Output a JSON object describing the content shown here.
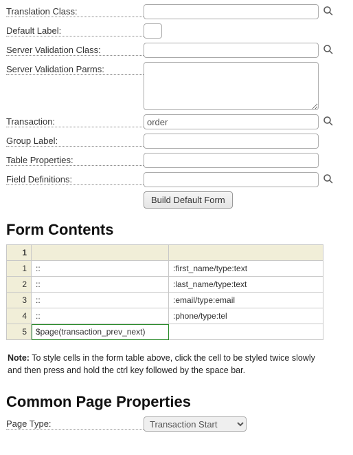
{
  "fields": {
    "translation_class": {
      "label": "Translation Class:",
      "value": ""
    },
    "default_label": {
      "label": "Default Label:",
      "value": ""
    },
    "server_validation_class": {
      "label": "Server Validation Class:",
      "value": ""
    },
    "server_validation_parms": {
      "label": "Server Validation Parms:",
      "value": ""
    },
    "transaction": {
      "label": "Transaction:",
      "value": "order"
    },
    "group_label": {
      "label": "Group Label:",
      "value": ""
    },
    "table_properties": {
      "label": "Table Properties:",
      "value": ""
    },
    "field_definitions": {
      "label": "Field Definitions:",
      "value": ""
    }
  },
  "buttons": {
    "build_default_form": "Build Default Form"
  },
  "sections": {
    "form_contents": "Form Contents",
    "common_page_properties": "Common Page Properties"
  },
  "grid": {
    "corner": "1",
    "rows": [
      {
        "n": "1",
        "c1": "::",
        "c2": ":first_name/type:text"
      },
      {
        "n": "2",
        "c1": "::",
        "c2": ":last_name/type:text"
      },
      {
        "n": "3",
        "c1": "::",
        "c2": ":email/type:email"
      },
      {
        "n": "4",
        "c1": "::",
        "c2": ":phone/type:tel"
      },
      {
        "n": "5",
        "c1": "$page(transaction_prev_next)",
        "c2": ""
      }
    ],
    "selected": {
      "row": 4,
      "col": 1
    }
  },
  "note": {
    "prefix": "Note:",
    "text": " To style cells in the form table above, click the cell to be styled twice slowly and then press and hold the ctrl key followed by the space bar."
  },
  "page_type": {
    "label": "Page Type:",
    "value": "Transaction Start",
    "options": [
      "Transaction Start"
    ]
  },
  "icons": {
    "search": "search-icon"
  }
}
